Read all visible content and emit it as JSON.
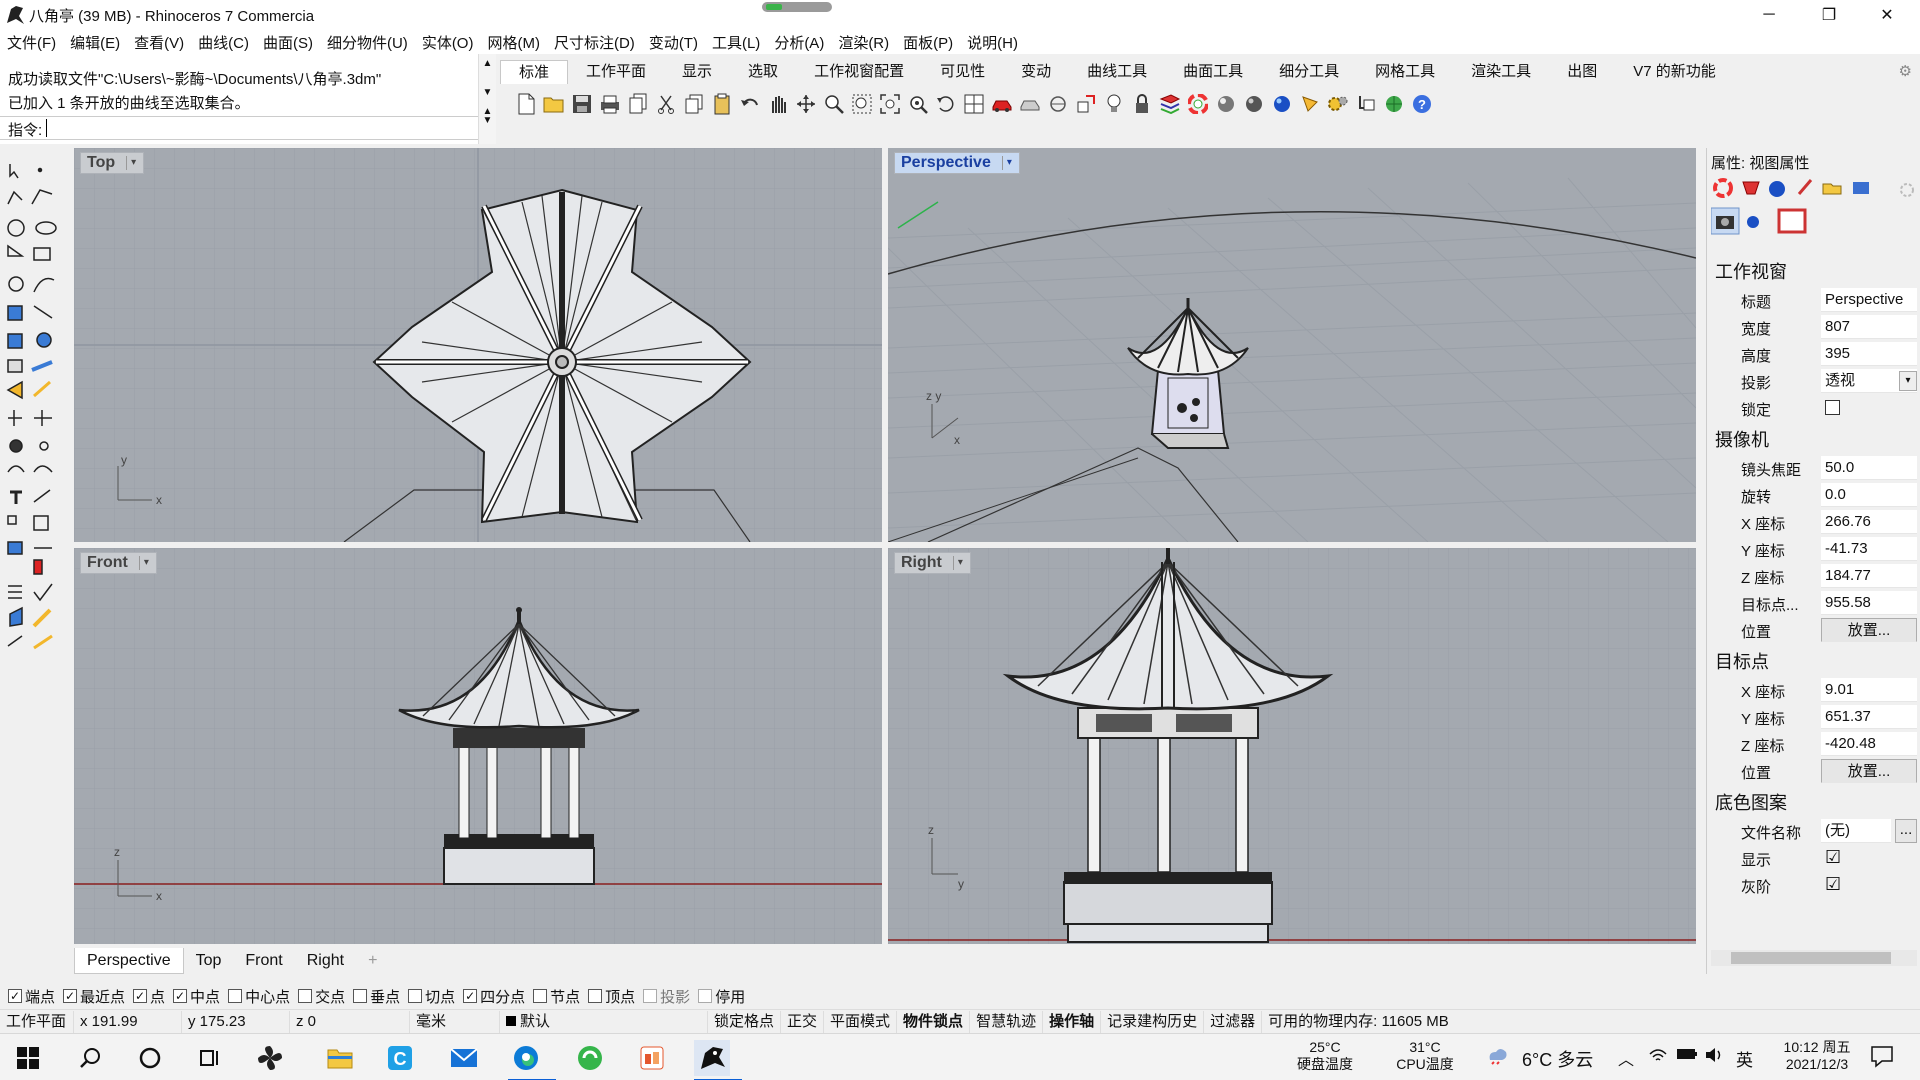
{
  "window": {
    "title": "八角亭 (39 MB) - Rhinoceros 7 Commercia",
    "minimize": "─",
    "maximize": "❐",
    "close": "✕"
  },
  "menu": [
    "文件(F)",
    "编辑(E)",
    "查看(V)",
    "曲线(C)",
    "曲面(S)",
    "细分物件(U)",
    "实体(O)",
    "网格(M)",
    "尺寸标注(D)",
    "变动(T)",
    "工具(L)",
    "分析(A)",
    "渲染(R)",
    "面板(P)",
    "说明(H)"
  ],
  "command": {
    "line1": "成功读取文件\"C:\\Users\\~影酶~\\Documents\\八角亭.3dm\"",
    "line2": "已加入 1 条开放的曲线至选取集合。",
    "prompt_label": "指令:",
    "prompt_value": ""
  },
  "toolbar_tabs": [
    "标准",
    "工作平面",
    "显示",
    "选取",
    "工作视窗配置",
    "可见性",
    "变动",
    "曲线工具",
    "曲面工具",
    "细分工具",
    "网格工具",
    "渲染工具",
    "出图",
    "V7 的新功能"
  ],
  "active_tab": "标准",
  "viewports": {
    "top": {
      "label": "Top"
    },
    "perspective": {
      "label": "Perspective"
    },
    "front": {
      "label": "Front"
    },
    "right": {
      "label": "Right"
    }
  },
  "viewport_tabs": [
    "Perspective",
    "Top",
    "Front",
    "Right"
  ],
  "viewport_tab_add": "+",
  "osnaps": [
    {
      "label": "端点",
      "checked": true
    },
    {
      "label": "最近点",
      "checked": true
    },
    {
      "label": "点",
      "checked": true
    },
    {
      "label": "中点",
      "checked": true
    },
    {
      "label": "中心点",
      "checked": false
    },
    {
      "label": "交点",
      "checked": false
    },
    {
      "label": "垂点",
      "checked": false
    },
    {
      "label": "切点",
      "checked": false
    },
    {
      "label": "四分点",
      "checked": true
    },
    {
      "label": "节点",
      "checked": false
    },
    {
      "label": "顶点",
      "checked": false
    },
    {
      "label": "投影",
      "checked": false
    },
    {
      "label": "停用",
      "checked": false
    }
  ],
  "status": {
    "cplane": "工作平面",
    "x": "x 191.99",
    "y": "y 175.23",
    "z": "z 0",
    "unit": "毫米",
    "layer": "默认",
    "items": [
      "锁定格点",
      "正交",
      "平面模式",
      "物件锁点",
      "智慧轨迹",
      "操作轴",
      "记录建构历史",
      "过滤器"
    ],
    "memory": "可用的物理内存: 11605 MB"
  },
  "properties": {
    "header": "属性: 视图属性",
    "section_viewport": "工作视窗",
    "viewport_rows": [
      {
        "k": "标题",
        "v": "Perspective"
      },
      {
        "k": "宽度",
        "v": "807"
      },
      {
        "k": "高度",
        "v": "395"
      },
      {
        "k": "投影",
        "v": "透视"
      },
      {
        "k": "锁定",
        "v": ""
      }
    ],
    "section_camera": "摄像机",
    "camera_rows": [
      {
        "k": "镜头焦距",
        "v": "50.0"
      },
      {
        "k": "旋转",
        "v": "0.0"
      },
      {
        "k": "X 座标",
        "v": "266.76"
      },
      {
        "k": "Y 座标",
        "v": "-41.73"
      },
      {
        "k": "Z 座标",
        "v": "184.77"
      },
      {
        "k": "目标点...",
        "v": "955.58"
      },
      {
        "k": "位置",
        "v": "放置..."
      }
    ],
    "section_target": "目标点",
    "target_rows": [
      {
        "k": "X 座标",
        "v": "9.01"
      },
      {
        "k": "Y 座标",
        "v": "651.37"
      },
      {
        "k": "Z 座标",
        "v": "-420.48"
      },
      {
        "k": "位置",
        "v": "放置..."
      }
    ],
    "section_wallpaper": "底色图案",
    "wallpaper_rows": [
      {
        "k": "文件名称",
        "v": "(无)"
      },
      {
        "k": "显示",
        "v": "☑"
      },
      {
        "k": "灰阶",
        "v": "☑"
      }
    ],
    "browse": "..."
  },
  "taskbar": {
    "temp_disk": "25°C",
    "temp_disk_label": "硬盘温度",
    "temp_cpu": "31°C",
    "temp_cpu_label": "CPU温度",
    "weather": "6°C 多云",
    "ime": "英",
    "time": "10:12 周五",
    "date": "2021/12/3"
  }
}
